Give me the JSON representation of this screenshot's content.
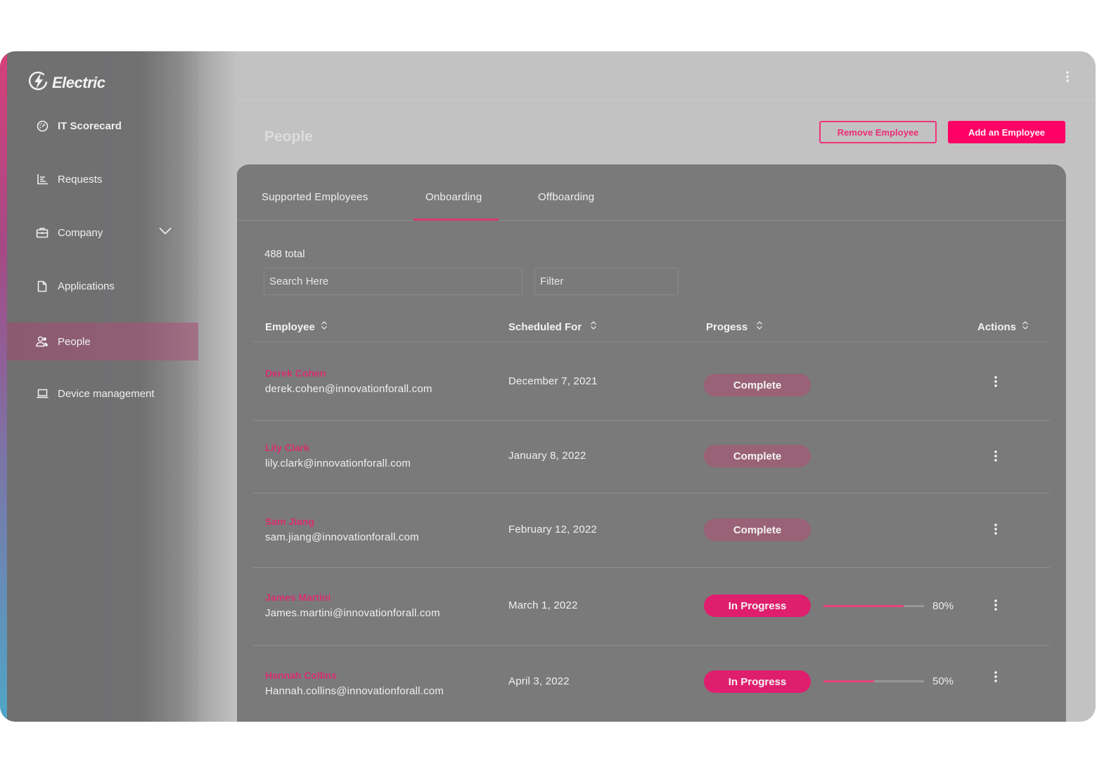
{
  "app": {
    "brand": "Electric",
    "accent_color": "#ff0066"
  },
  "sidebar": {
    "items": [
      {
        "label": "IT Scorecard",
        "icon": "gauge-icon",
        "bold": true
      },
      {
        "label": "Requests",
        "icon": "bar-list-icon"
      },
      {
        "label": "Company",
        "icon": "briefcase-icon",
        "expandable": true
      },
      {
        "label": "Applications",
        "icon": "document-icon"
      },
      {
        "label": "People",
        "icon": "people-icon",
        "active": true
      },
      {
        "label": "Device management",
        "icon": "laptop-icon"
      }
    ]
  },
  "header": {
    "title": "People",
    "remove_button": "Remove Employee",
    "add_button": "Add an Employee",
    "menu_icon": "kebab-icon"
  },
  "tabs": [
    {
      "label": "Supported  Employees"
    },
    {
      "label": "Onboarding",
      "active": true
    },
    {
      "label": "Offboarding"
    }
  ],
  "list": {
    "total": "488 total",
    "search_placeholder": "Search Here",
    "filter_placeholder": "Filter"
  },
  "table": {
    "columns": [
      "Employee",
      "Scheduled For",
      "Progess",
      "Actions"
    ],
    "rows": [
      {
        "name": "Derek Cohen",
        "email": "derek.cohen@innovationforall.com",
        "date": "December 7, 2021",
        "status": "Complete"
      },
      {
        "name": "Lily Clark",
        "email": "lily.clark@innovationforall.com",
        "date": "January 8, 2022",
        "status": "Complete"
      },
      {
        "name": "Sam Jiang",
        "email": "sam.jiang@innovationforall.com",
        "date": "February 12, 2022",
        "status": "Complete"
      },
      {
        "name": "James Martini",
        "email": "James.martini@innovationforall.com",
        "date": "March 1, 2022",
        "status": "In Progress",
        "progress": 80,
        "progress_label": "80%"
      },
      {
        "name": "Hannah Collins",
        "email": "Hannah.collins@innovationforall.com",
        "date": "April 3, 2022",
        "status": "In Progress",
        "progress": 50,
        "progress_label": "50%"
      }
    ]
  }
}
